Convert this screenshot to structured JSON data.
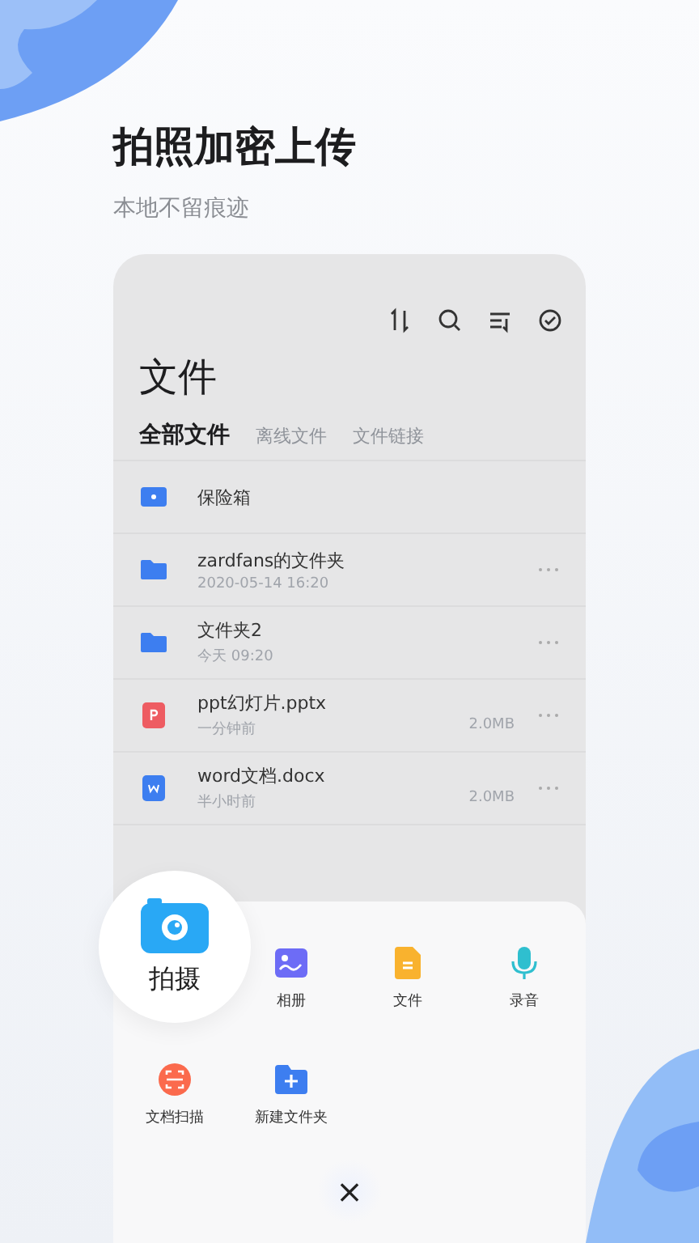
{
  "hero": {
    "title": "拍照加密上传",
    "subtitle": "本地不留痕迹"
  },
  "screen": {
    "title": "文件",
    "tabs": [
      {
        "label": "全部文件",
        "selected": true
      },
      {
        "label": "离线文件",
        "selected": false
      },
      {
        "label": "文件链接",
        "selected": false
      }
    ],
    "files": [
      {
        "kind": "vault",
        "name": "保险箱"
      },
      {
        "kind": "folder",
        "name": "zardfans的文件夹",
        "time": "2020-05-14 16:20"
      },
      {
        "kind": "folder",
        "name": "文件夹2",
        "time": "今天 09:20"
      },
      {
        "kind": "ppt",
        "name": "ppt幻灯片.pptx",
        "time": "一分钟前",
        "size": "2.0MB"
      },
      {
        "kind": "word",
        "name": "word文档.docx",
        "time": "半小时前",
        "size": "2.0MB"
      }
    ]
  },
  "upload_sheet": {
    "actions": [
      {
        "kind": "camera",
        "label": "拍摄"
      },
      {
        "kind": "album",
        "label": "相册"
      },
      {
        "kind": "file",
        "label": "文件"
      },
      {
        "kind": "audio",
        "label": "录音"
      },
      {
        "kind": "scan",
        "label": "文档扫描"
      },
      {
        "kind": "newfolder",
        "label": "新建文件夹"
      }
    ],
    "close": "×"
  }
}
